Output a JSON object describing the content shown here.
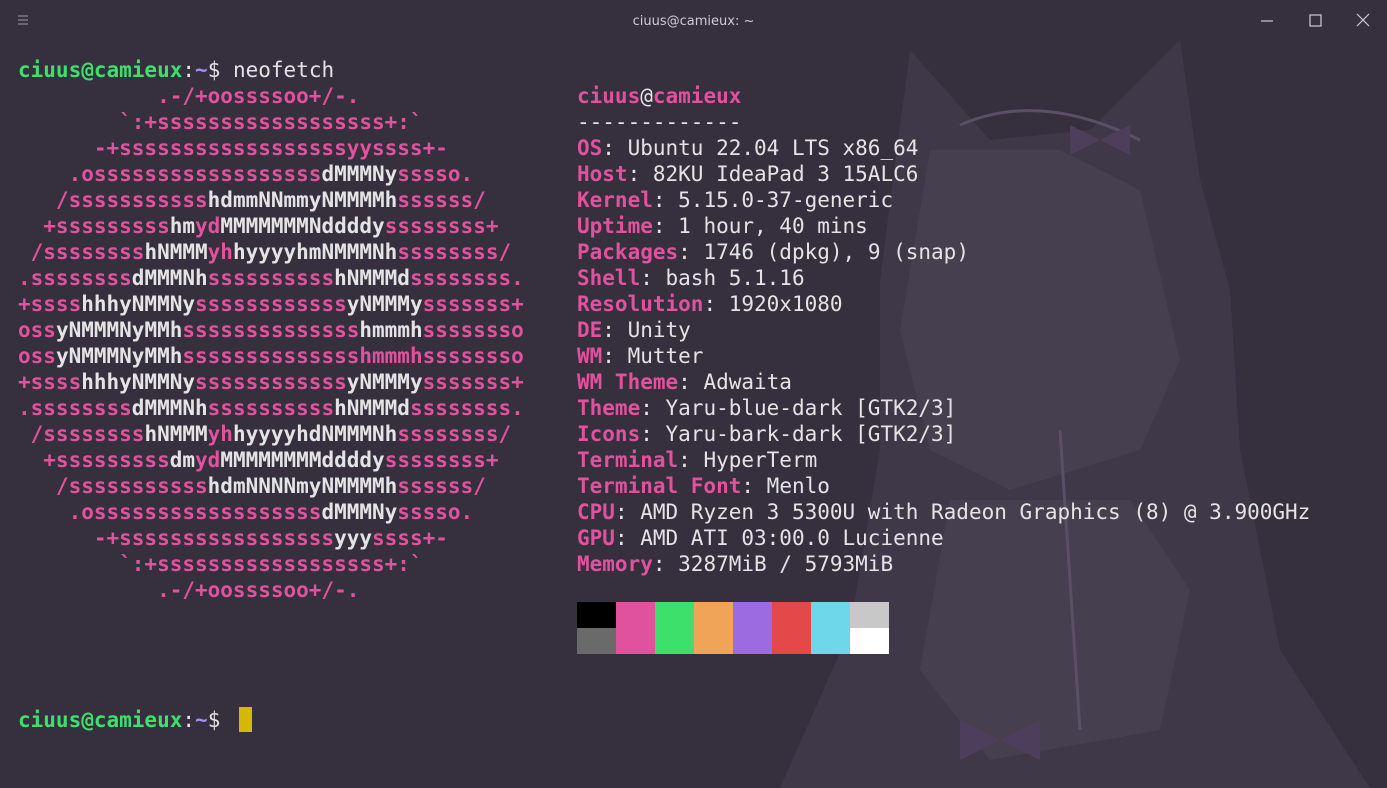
{
  "window": {
    "title": "ciuus@camieux: ~",
    "menu_icon": "hamburger-menu-icon",
    "minimize_icon": "minimize-icon",
    "maximize_icon": "maximize-icon",
    "close_icon": "close-icon"
  },
  "prompt1": {
    "user": "ciuus@camieux",
    "colon": ":",
    "path": "~",
    "dollar": "$ ",
    "command": "neofetch"
  },
  "prompt2": {
    "user": "ciuus@camieux",
    "colon": ":",
    "path": "~",
    "dollar": "$ "
  },
  "logo_lines": [
    [
      [
        "p",
        "           .-/+oossssoo+/-."
      ]
    ],
    [
      [
        "p",
        "        `:+ssssssssssssssssss+:`"
      ]
    ],
    [
      [
        "p",
        "      -+ssssssssssssssssssyyssss+-"
      ]
    ],
    [
      [
        "p",
        "    .ossssssssssssssssss"
      ],
      [
        "w",
        "dMMMNy"
      ],
      [
        "p",
        "sssso."
      ]
    ],
    [
      [
        "p",
        "   /sssssssssss"
      ],
      [
        "w",
        "hdmmNNmmyNMMMMh"
      ],
      [
        "p",
        "ssssss/"
      ]
    ],
    [
      [
        "p",
        "  +sssssssss"
      ],
      [
        "w",
        "hm"
      ],
      [
        "pb",
        "yd"
      ],
      [
        "w",
        "MMMMMMMNddddy"
      ],
      [
        "p",
        "ssssssss+"
      ]
    ],
    [
      [
        "p",
        " /ssssssss"
      ],
      [
        "w",
        "hNMMM"
      ],
      [
        "pb",
        "yh"
      ],
      [
        "w",
        "hyyyyhmNMMMNh"
      ],
      [
        "p",
        "ssssssss/"
      ]
    ],
    [
      [
        "p",
        ".ssssssss"
      ],
      [
        "w",
        "dMMMNh"
      ],
      [
        "p",
        "ssssssssss"
      ],
      [
        "w",
        "hNMMMd"
      ],
      [
        "p",
        "ssssssss."
      ]
    ],
    [
      [
        "p",
        "+ssss"
      ],
      [
        "w",
        "hhhyNMMNy"
      ],
      [
        "p",
        "ssssssssssss"
      ],
      [
        "w",
        "yNMMMy"
      ],
      [
        "p",
        "sssssss+"
      ]
    ],
    [
      [
        "p",
        "oss"
      ],
      [
        "w",
        "yNMMMNyMMh"
      ],
      [
        "p",
        "ssssssssssssss"
      ],
      [
        "w",
        "hmmmh"
      ],
      [
        "p",
        "ssssssso"
      ]
    ],
    [
      [
        "p",
        "oss"
      ],
      [
        "w",
        "yNMMMNyMMh"
      ],
      [
        "p",
        "sssssssssssssshmmmhssssssso"
      ]
    ],
    [
      [
        "p",
        "+ssss"
      ],
      [
        "w",
        "hhhyNMMNy"
      ],
      [
        "p",
        "ssssssssssss"
      ],
      [
        "w",
        "yNMMMy"
      ],
      [
        "p",
        "sssssss+"
      ]
    ],
    [
      [
        "p",
        ".ssssssss"
      ],
      [
        "w",
        "dMMMNh"
      ],
      [
        "p",
        "ssssssssss"
      ],
      [
        "w",
        "hNMMMd"
      ],
      [
        "p",
        "ssssssss."
      ]
    ],
    [
      [
        "p",
        " /ssssssss"
      ],
      [
        "w",
        "hNMMM"
      ],
      [
        "pb",
        "yh"
      ],
      [
        "w",
        "hyyyyhdNMMMNh"
      ],
      [
        "p",
        "ssssssss/"
      ]
    ],
    [
      [
        "p",
        "  +sssssssss"
      ],
      [
        "w",
        "dm"
      ],
      [
        "pb",
        "yd"
      ],
      [
        "w",
        "MMMMMMMMddddy"
      ],
      [
        "p",
        "ssssssss+"
      ]
    ],
    [
      [
        "p",
        "   /sssssssssss"
      ],
      [
        "w",
        "hdmNNNNmyNMMMMh"
      ],
      [
        "p",
        "ssssss/"
      ]
    ],
    [
      [
        "p",
        "    .ossssssssssssssssss"
      ],
      [
        "w",
        "dMMMNy"
      ],
      [
        "p",
        "sssso."
      ]
    ],
    [
      [
        "p",
        "      -+sssssssssssssssss"
      ],
      [
        "w",
        "yyy"
      ],
      [
        "p",
        "ssss+-"
      ]
    ],
    [
      [
        "p",
        "        `:+ssssssssssssssssss+:`"
      ]
    ],
    [
      [
        "p",
        "           .-/+oossssoo+/-."
      ]
    ]
  ],
  "info": {
    "user": "ciuus",
    "at": "@",
    "host": "camieux",
    "separator": "-------------",
    "rows": [
      {
        "key": "OS",
        "value": "Ubuntu 22.04 LTS x86_64"
      },
      {
        "key": "Host",
        "value": "82KU IdeaPad 3 15ALC6"
      },
      {
        "key": "Kernel",
        "value": "5.15.0-37-generic"
      },
      {
        "key": "Uptime",
        "value": "1 hour, 40 mins"
      },
      {
        "key": "Packages",
        "value": "1746 (dpkg), 9 (snap)"
      },
      {
        "key": "Shell",
        "value": "bash 5.1.16"
      },
      {
        "key": "Resolution",
        "value": "1920x1080"
      },
      {
        "key": "DE",
        "value": "Unity"
      },
      {
        "key": "WM",
        "value": "Mutter"
      },
      {
        "key": "WM Theme",
        "value": "Adwaita"
      },
      {
        "key": "Theme",
        "value": "Yaru-blue-dark [GTK2/3]"
      },
      {
        "key": "Icons",
        "value": "Yaru-bark-dark [GTK2/3]"
      },
      {
        "key": "Terminal",
        "value": "HyperTerm"
      },
      {
        "key": "Terminal Font",
        "value": "Menlo"
      },
      {
        "key": "CPU",
        "value": "AMD Ryzen 3 5300U with Radeon Graphics (8) @ 3.900GHz"
      },
      {
        "key": "GPU",
        "value": "AMD ATI 03:00.0 Lucienne"
      },
      {
        "key": "Memory",
        "value": "3287MiB / 5793MiB"
      }
    ],
    "key_suffix": ": "
  },
  "palette": {
    "normal": [
      "#000000",
      "#e0529d",
      "#3ee06c",
      "#f0a458",
      "#9b6bdf",
      "#e54848",
      "#6fd7ea",
      "#c8c8c8"
    ],
    "bright": [
      "#6a6a6a",
      "#e0529d",
      "#3ee06c",
      "#f0a458",
      "#9b6bdf",
      "#e54848",
      "#6fd7ea",
      "#ffffff"
    ]
  }
}
